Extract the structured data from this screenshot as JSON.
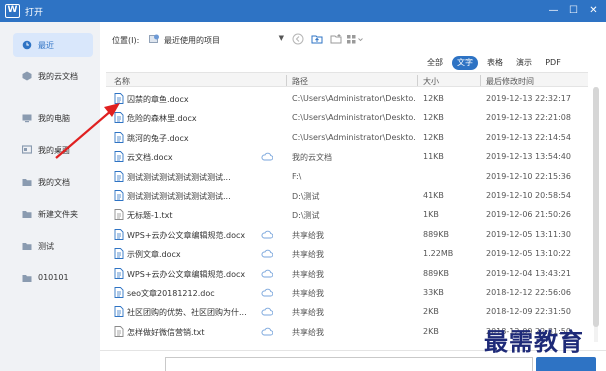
{
  "window": {
    "title": "打开"
  },
  "sidebar": {
    "items": [
      {
        "label": "最近",
        "icon": "clock-icon",
        "active": true
      },
      {
        "label": "我的云文档",
        "icon": "cloud-doc-icon",
        "active": false
      },
      {
        "label": "我的电脑",
        "icon": "computer-icon",
        "active": false
      },
      {
        "label": "我的桌面",
        "icon": "desktop-icon",
        "active": false
      },
      {
        "label": "我的文档",
        "icon": "folder-icon",
        "active": false
      },
      {
        "label": "新建文件夹",
        "icon": "folder-icon",
        "active": false
      },
      {
        "label": "测试",
        "icon": "folder-icon",
        "active": false
      },
      {
        "label": "010101",
        "icon": "folder-icon",
        "active": false
      }
    ]
  },
  "toolbar": {
    "location_label": "位置(I):",
    "location_value": "最近使用的项目"
  },
  "filters": [
    {
      "label": "全部",
      "active": false
    },
    {
      "label": "文字",
      "active": true
    },
    {
      "label": "表格",
      "active": false
    },
    {
      "label": "演示",
      "active": false
    },
    {
      "label": "PDF",
      "active": false
    }
  ],
  "table": {
    "columns": [
      "名称",
      "路径",
      "大小",
      "最后修改时间"
    ],
    "rows": [
      {
        "name": "囚禁的章鱼.docx",
        "path": "C:\\Users\\Administrator\\Deskto...",
        "size": "12KB",
        "date": "2019-12-13 22:32:17",
        "cloud": false
      },
      {
        "name": "危险的森林里.docx",
        "path": "C:\\Users\\Administrator\\Deskto...",
        "size": "12KB",
        "date": "2019-12-13 22:21:08",
        "cloud": false
      },
      {
        "name": "跳河的兔子.docx",
        "path": "C:\\Users\\Administrator\\Deskto...",
        "size": "12KB",
        "date": "2019-12-13 22:14:54",
        "cloud": false
      },
      {
        "name": "云文档.docx",
        "path": "我的云文档",
        "size": "11KB",
        "date": "2019-12-13 13:54:40",
        "cloud": true
      },
      {
        "name": "测试测试测试测试测试测试...",
        "path": "F:\\",
        "size": "",
        "date": "2019-12-10 22:15:36",
        "cloud": false
      },
      {
        "name": "测试测试测试测试测试测试...",
        "path": "D:\\测试",
        "size": "41KB",
        "date": "2019-12-10 20:58:54",
        "cloud": false
      },
      {
        "name": "无标题-1.txt",
        "path": "D:\\测试",
        "size": "1KB",
        "date": "2019-12-06 21:50:26",
        "cloud": false
      },
      {
        "name": "WPS+云办公文章编辑规范.docx",
        "path": "共享给我",
        "size": "889KB",
        "date": "2019-12-05 13:11:30",
        "cloud": true
      },
      {
        "name": "示例文章.docx",
        "path": "共享给我",
        "size": "1.22MB",
        "date": "2019-12-05 13:10:22",
        "cloud": true
      },
      {
        "name": "WPS+云办公文章编辑规范.docx",
        "path": "共享给我",
        "size": "889KB",
        "date": "2019-12-04 13:43:21",
        "cloud": true
      },
      {
        "name": "seo文章20181212.doc",
        "path": "共享给我",
        "size": "33KB",
        "date": "2018-12-12 22:56:06",
        "cloud": true
      },
      {
        "name": "社区团购的优势、社区团购为什...",
        "path": "共享给我",
        "size": "2KB",
        "date": "2018-12-09 22:31:50",
        "cloud": true
      },
      {
        "name": "怎样做好微信营销.txt",
        "path": "共享给我",
        "size": "2KB",
        "date": "2018-12-09 22:31:50",
        "cloud": true
      }
    ]
  },
  "colors": {
    "accent": "#2e73c4",
    "doc_icon": "#2e73c4",
    "txt_icon": "#8a8a8a",
    "arrow": "#e02020"
  },
  "watermark": "最需教育"
}
